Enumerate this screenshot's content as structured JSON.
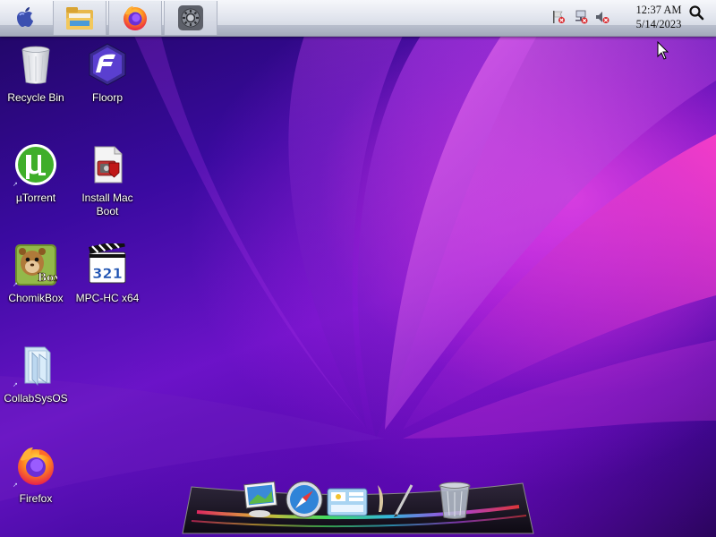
{
  "taskbar": {
    "pinned": [
      {
        "name": "File Explorer"
      },
      {
        "name": "Firefox"
      },
      {
        "name": "Settings"
      }
    ],
    "clock": {
      "time": "12:37 AM",
      "date": "5/14/2023"
    }
  },
  "desktop_icons": [
    {
      "label": "Recycle Bin",
      "icon": "recycle-bin-icon"
    },
    {
      "label": "Floorp",
      "icon": "floorp-icon"
    },
    {
      "label": "µTorrent",
      "icon": "utorrent-icon"
    },
    {
      "label": "Install Mac\nBoot",
      "icon": "installer-icon"
    },
    {
      "label": "ChomikBox",
      "icon": "chomikbox-icon"
    },
    {
      "label": "MPC-HC x64",
      "icon": "mpc-hc-icon"
    },
    {
      "label": "CollabSysOS",
      "icon": "folder-icon"
    },
    {
      "label": "Firefox",
      "icon": "firefox-icon"
    }
  ],
  "chomikbox_badge": "Box",
  "mpc_badge": "321",
  "dock_items": [
    {
      "icon": "preview-icon"
    },
    {
      "icon": "safari-icon"
    },
    {
      "icon": "dashboard-icon"
    },
    {
      "icon": "quill-icon"
    },
    {
      "icon": "trash-icon"
    }
  ],
  "colors": {
    "wallpaper_dark": "#1e0660",
    "wallpaper_mid": "#6a14c8",
    "wallpaper_glow": "#ff50e6"
  }
}
